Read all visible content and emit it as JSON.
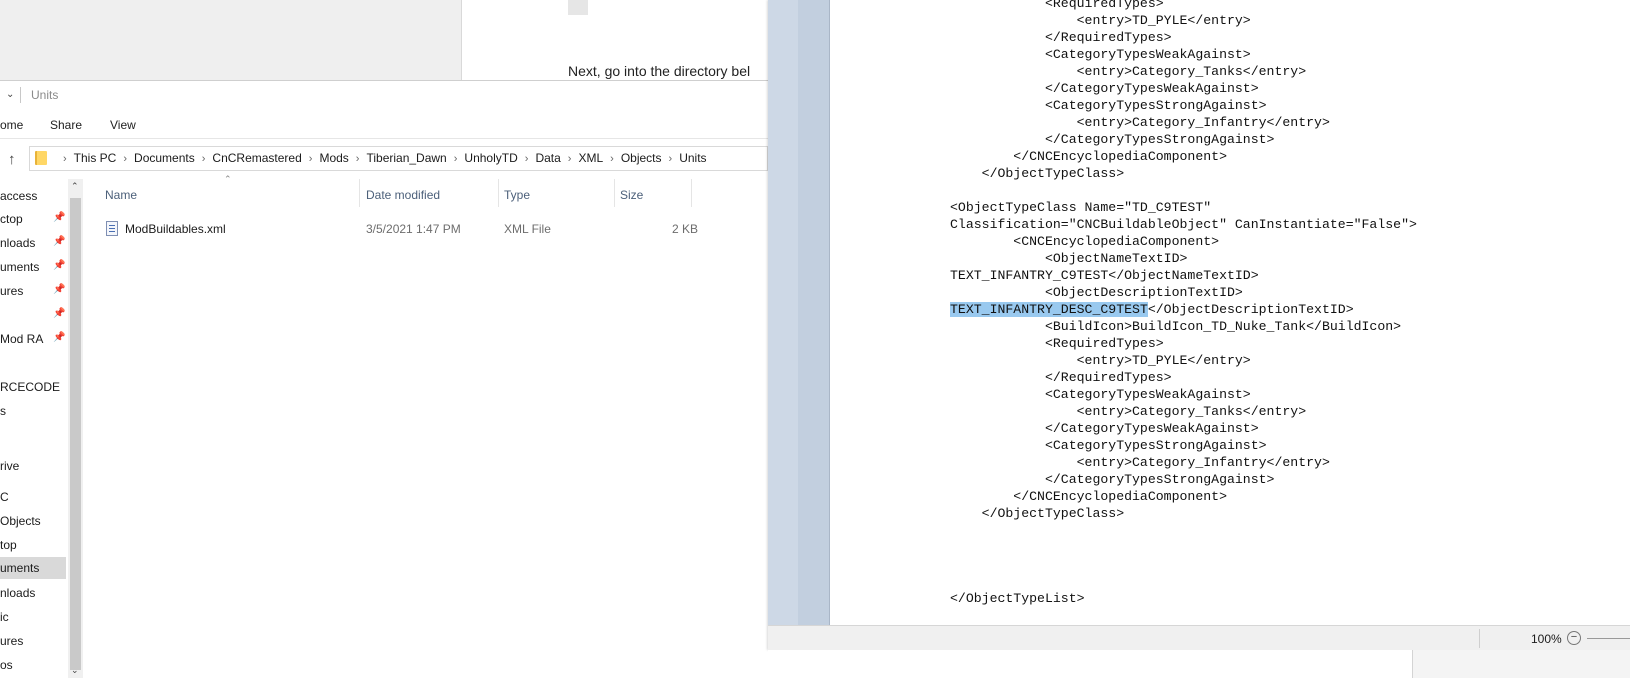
{
  "background_doc": {
    "text": "Next, go into the directory bel"
  },
  "explorer": {
    "title": "Units",
    "ribbon": [
      "ome",
      "Share",
      "View"
    ],
    "address": [
      "This PC",
      "Documents",
      "CnCRemastered",
      "Mods",
      "Tiberian_Dawn",
      "UnholyTD",
      "Data",
      "XML",
      "Objects",
      "Units"
    ],
    "nav_items": [
      {
        "label": "access",
        "pinned": false
      },
      {
        "label": "ctop",
        "pinned": true
      },
      {
        "label": "nloads",
        "pinned": true
      },
      {
        "label": "uments",
        "pinned": true
      },
      {
        "label": "ures",
        "pinned": true
      },
      {
        "label": "",
        "pinned": true
      },
      {
        "label": "Mod RA",
        "pinned": true
      },
      {
        "label": "RCECODE",
        "pinned": false
      },
      {
        "label": "s",
        "pinned": false
      },
      {
        "label": "rive",
        "pinned": false
      },
      {
        "label": "C",
        "pinned": false
      },
      {
        "label": "Objects",
        "pinned": false
      },
      {
        "label": "top",
        "pinned": false
      },
      {
        "label": "uments",
        "pinned": false,
        "selected": true
      },
      {
        "label": "nloads",
        "pinned": false
      },
      {
        "label": "ic",
        "pinned": false
      },
      {
        "label": "ures",
        "pinned": false
      },
      {
        "label": "os",
        "pinned": false
      }
    ],
    "columns": [
      "Name",
      "Date modified",
      "Type",
      "Size"
    ],
    "files": [
      {
        "name": "ModBuildables.xml",
        "date": "3/5/2021 1:47 PM",
        "type": "XML File",
        "size": "2 KB"
      }
    ]
  },
  "notepad": {
    "lines": [
      "            <RequiredTypes>",
      "                <entry>TD_PYLE</entry>",
      "            </RequiredTypes>",
      "            <CategoryTypesWeakAgainst>",
      "                <entry>Category_Tanks</entry>",
      "            </CategoryTypesWeakAgainst>",
      "            <CategoryTypesStrongAgainst>",
      "                <entry>Category_Infantry</entry>",
      "            </CategoryTypesStrongAgainst>",
      "        </CNCEncyclopediaComponent>",
      "    </ObjectTypeClass>",
      "",
      "<ObjectTypeClass Name=\"TD_C9TEST\"",
      "Classification=\"CNCBuildableObject\" CanInstantiate=\"False\">",
      "        <CNCEncyclopediaComponent>",
      "            <ObjectNameTextID>",
      "TEXT_INFANTRY_C9TEST</ObjectNameTextID>",
      "            <ObjectDescriptionTextID>",
      "TEXT_INFANTRY_DESC_C9TEST</ObjectDescriptionTextID>",
      "            <BuildIcon>BuildIcon_TD_Nuke_Tank</BuildIcon>",
      "            <RequiredTypes>",
      "                <entry>TD_PYLE</entry>",
      "            </RequiredTypes>",
      "            <CategoryTypesWeakAgainst>",
      "                <entry>Category_Tanks</entry>",
      "            </CategoryTypesWeakAgainst>",
      "            <CategoryTypesStrongAgainst>",
      "                <entry>Category_Infantry</entry>",
      "            </CategoryTypesStrongAgainst>",
      "        </CNCEncyclopediaComponent>",
      "    </ObjectTypeClass>",
      "",
      "",
      "",
      "",
      "</ObjectTypeList>"
    ],
    "highlight": {
      "line": 18,
      "text": "TEXT_INFANTRY_DESC_C9TEST"
    },
    "zoom": "100%",
    "zoom_minus": "−"
  },
  "icons": {
    "up": "↑",
    "chevron": "›",
    "pin": "📌",
    "scroll_up": "⌃",
    "scroll_down": "⌄",
    "title_down": "⌄",
    "sort_up": "⌃"
  },
  "colors": {
    "selection": "#99c9ef",
    "nav_selected": "#d9d9d9",
    "header_text": "#4c607a",
    "gutter": "#c2cfdf"
  }
}
